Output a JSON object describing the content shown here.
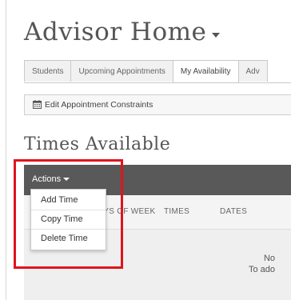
{
  "page": {
    "title": "Advisor Home"
  },
  "tabs": [
    {
      "label": "Students",
      "active": false
    },
    {
      "label": "Upcoming Appointments",
      "active": false
    },
    {
      "label": "My Availability",
      "active": true
    },
    {
      "label": "Adv",
      "active": false
    }
  ],
  "toolbar": {
    "edit_constraints_label": "Edit Appointment Constraints"
  },
  "section": {
    "title": "Times Available"
  },
  "table": {
    "actions_label": "Actions",
    "columns": [
      "AYS OF WEEK",
      "TIMES",
      "DATES"
    ],
    "empty_line_1": "No",
    "empty_line_2": "To ado"
  },
  "actions_menu": {
    "items": [
      "Add Time",
      "Copy Time",
      "Delete Time"
    ]
  },
  "colors": {
    "header_bar": "#595959",
    "highlight": "#e0141b"
  }
}
